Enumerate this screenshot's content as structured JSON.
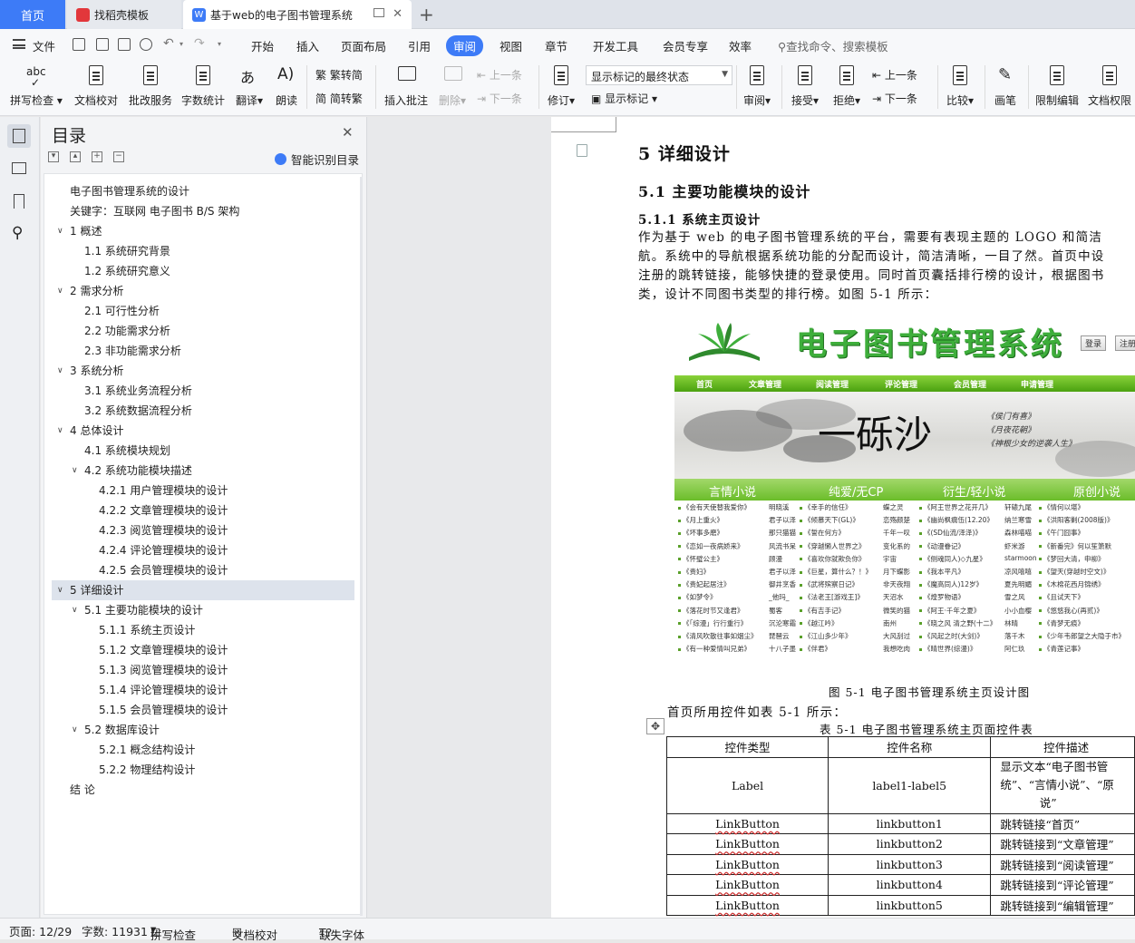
{
  "tabs": {
    "home": "首页",
    "template": "找稻壳模板",
    "document": "基于web的电子图书管理系统"
  },
  "menu": {
    "file": "文件",
    "items": [
      "开始",
      "插入",
      "页面布局",
      "引用",
      "审阅",
      "视图",
      "章节",
      "开发工具",
      "会员专享",
      "效率"
    ],
    "active": "审阅",
    "search": "查找命令、搜索模板"
  },
  "ribbon": {
    "spellcheck": "拼写检查",
    "doc_check": "文档校对",
    "annotate_service": "批改服务",
    "word_count": "字数统计",
    "translate": "翻译",
    "read_aloud": "朗读",
    "to_traditional": "繁转简",
    "to_simplified": "简转繁",
    "insert_comment": "插入批注",
    "delete": "删除",
    "prev": "上一条",
    "next": "下一条",
    "revise": "修订",
    "markup_select": "显示标记的最终状态",
    "show_markup": "显示标记",
    "review": "审阅",
    "accept": "接受",
    "reject": "拒绝",
    "prev2": "上一条",
    "next2": "下一条",
    "compare": "比较",
    "ink": "画笔",
    "restrict_edit": "限制编辑",
    "doc_rights": "文档权限"
  },
  "toc": {
    "title": "目录",
    "smart_label": "智能识别目录",
    "items": [
      {
        "text": "电子图书管理系统的设计",
        "level": 0,
        "caret": false
      },
      {
        "text": "关键字：互联网  电子图书  B/S 架构",
        "level": 0,
        "caret": false
      },
      {
        "text": "1 概述",
        "level": 0,
        "caret": true
      },
      {
        "text": "1.1 系统研究背景",
        "level": 1,
        "caret": false
      },
      {
        "text": "1.2 系统研究意义",
        "level": 1,
        "caret": false
      },
      {
        "text": "2  需求分析",
        "level": 0,
        "caret": true
      },
      {
        "text": "2.1 可行性分析",
        "level": 1,
        "caret": false
      },
      {
        "text": "2.2 功能需求分析",
        "level": 1,
        "caret": false
      },
      {
        "text": "2.3 非功能需求分析",
        "level": 1,
        "caret": false
      },
      {
        "text": "3 系统分析",
        "level": 0,
        "caret": true
      },
      {
        "text": "3.1 系统业务流程分析",
        "level": 1,
        "caret": false
      },
      {
        "text": "3.2 系统数据流程分析",
        "level": 1,
        "caret": false
      },
      {
        "text": "4 总体设计",
        "level": 0,
        "caret": true
      },
      {
        "text": "4.1 系统模块规划",
        "level": 1,
        "caret": false
      },
      {
        "text": "4.2 系统功能模块描述",
        "level": 1,
        "caret": true
      },
      {
        "text": "4.2.1 用户管理模块的设计",
        "level": 2,
        "caret": false
      },
      {
        "text": "4.2.2 文章管理模块的设计",
        "level": 2,
        "caret": false
      },
      {
        "text": "4.2.3 阅览管理模块的设计",
        "level": 2,
        "caret": false
      },
      {
        "text": "4.2.4 评论管理模块的设计",
        "level": 2,
        "caret": false
      },
      {
        "text": "4.2.5 会员管理模块的设计",
        "level": 2,
        "caret": false
      },
      {
        "text": "5  详细设计",
        "level": 0,
        "caret": true,
        "selected": true
      },
      {
        "text": "5.1 主要功能模块的设计",
        "level": 1,
        "caret": true
      },
      {
        "text": "5.1.1 系统主页设计",
        "level": 2,
        "caret": false
      },
      {
        "text": "5.1.2 文章管理模块的设计",
        "level": 2,
        "caret": false
      },
      {
        "text": "5.1.3 阅览管理模块的设计",
        "level": 2,
        "caret": false
      },
      {
        "text": "5.1.4 评论管理模块的设计",
        "level": 2,
        "caret": false
      },
      {
        "text": "5.1.5 会员管理模块的设计",
        "level": 2,
        "caret": false
      },
      {
        "text": "5.2 数据库设计",
        "level": 1,
        "caret": true
      },
      {
        "text": "5.2.1 概念结构设计",
        "level": 2,
        "caret": false
      },
      {
        "text": "5.2.2 物理结构设计",
        "level": 2,
        "caret": false
      },
      {
        "text": "结    论",
        "level": 0,
        "caret": false
      }
    ]
  },
  "document": {
    "h1": "5 详细设计",
    "h2": "5.1 主要功能模块的设计",
    "h3": "5.1.1 系统主页设计",
    "para_lines": [
      "    作为基于 web 的电子图书管理系统的平台，需要有表现主题的 LOGO 和简洁",
      "航。系统中的导航根据系统功能的分配而设计，简洁清晰，一目了然。首页中设",
      "注册的跳转链接，能够快捷的登录使用。同时首页囊括排行榜的设计，根据图书",
      "类，设计不同图书类型的排行榜。如图 5-1 所示："
    ],
    "figure": {
      "site_title": "电子图书管理系统",
      "login_btn": "登录",
      "register_btn": "注册",
      "nav": [
        "首页",
        "文章管理",
        "阅读管理",
        "评论管理",
        "会员管理",
        "申请管理"
      ],
      "banner_big": "一砾沙",
      "banner_small": [
        "《侯门有喜》",
        "《月夜花朝》",
        "《神根少女的逆袭人生》"
      ],
      "categories": [
        "言情小说",
        "纯爱/无CP",
        "衍生/轻小说",
        "原创小说"
      ],
      "col1": [
        "《会有天使替我爱你》",
        "《月上重火》",
        "《坏事多磨》",
        "《恋如一夜病娇来》",
        "《怀璧公主》",
        "《贵妇》",
        "《贵妃起居注》",
        "《如梦令》",
        "《落花时节又逢君》",
        "《「综漫」行行重行》",
        "《清风吹散往事如烟尘》",
        "《有一种爱情叫兄弟》"
      ],
      "col1b": [
        "明晓溪",
        "君子以泽",
        "那只猫猫",
        "风流书呆",
        "顾漫",
        "君子以泽",
        "御井烹香",
        "_他玛_",
        "蜀客",
        "沉沦寒霜",
        "琵琶云",
        "十八子墨"
      ],
      "col2": [
        "《幸手的信任》",
        "《倾慕天下(GL)》",
        "《誓在何方》",
        "《穿越懒人世界之》",
        "《喜欢你就欺负你》",
        "《巨星，算什么？！》",
        "《武将殡察日记》",
        "《法老王[游戏王]》",
        "《有吉手记》",
        "《越江吟》",
        "《江山多少年》",
        "《伴君》"
      ],
      "col2b": [
        "蝶之灵",
        "恋殇颜楚",
        "千年一叹",
        "变化系的",
        "宇宙",
        "月下蝶影",
        "非天夜翔",
        "天沼水",
        "微笑的猫",
        "南州",
        "大风刮过",
        "我想吃肉"
      ],
      "col3": [
        "《阿王世界之花开几》",
        "《幽尚枫瘸伍(12.20》",
        "《(SD仙流/泽泽)》",
        "《动漫眷记》",
        "《侧魂同人)◇九星》",
        "《我本平凡》",
        "《魔高同人)12岁》",
        "《煌罗物语》",
        "《阿王·千年之夏》",
        "《晓之风 清之野(十二》",
        "《风起之时(大剑)》",
        "《晴世界(综漫)》"
      ],
      "col3b": [
        "轩辕九尾",
        "纳兰寒雪",
        "森林喵喵",
        "虾米游",
        "starmoon",
        "凉风嘻嘻",
        "夏先明媚",
        "雪之风",
        "小小血樱",
        "林晴",
        "落千木",
        "阿仁玖"
      ],
      "col4": [
        "《情何以堪》",
        "《洪阳客剿(2008版)》",
        "《午门囧事》",
        "《新番完》何以笙箫默",
        "《梦回大清，申柳》",
        "《望天(穿越时空文)》",
        "《木棉花西月锦绣》",
        "《且试天下》",
        "《悠悠我心(再贰)》",
        "《青梦无痕》",
        "《少年韦郎望之大隐于市》",
        "《青莲记事》"
      ],
      "caption": "图 5-1  电子图书管理系统主页设计图"
    },
    "para2": "首页所用控件如表 5-1 所示：",
    "table_caption": "表 5-1   电子图书管理系统主页面控件表",
    "table": {
      "headers": [
        "控件类型",
        "控件名称",
        "控件描述"
      ],
      "rows": [
        [
          "Label",
          "label1-label5",
          "显示文本“电子图书管理系统”、“言情小说”、“原创小说”"
        ],
        [
          "LinkButton",
          "linkbutton1",
          "跳转链接“首页”"
        ],
        [
          "LinkButton",
          "linkbutton2",
          "跳转链接到“文章管理”"
        ],
        [
          "LinkButton",
          "linkbutton3",
          "跳转链接到“阅读管理”"
        ],
        [
          "LinkButton",
          "linkbutton4",
          "跳转链接到“评论管理”"
        ],
        [
          "LinkButton",
          "linkbutton5",
          "跳转链接到“编辑管理”"
        ]
      ],
      "row1_desc_lines": [
        "显示文本“电子图书管",
        "统”、“言情小说”、“原",
        "说”"
      ]
    }
  },
  "status": {
    "page": "页面: 12/29",
    "words": "字数: 11931",
    "spell": "拼写检查",
    "check": "文档校对",
    "missing_font": "缺失字体"
  },
  "colors": {
    "accent": "#3d7bf7",
    "site_green": "#3eae3b"
  }
}
